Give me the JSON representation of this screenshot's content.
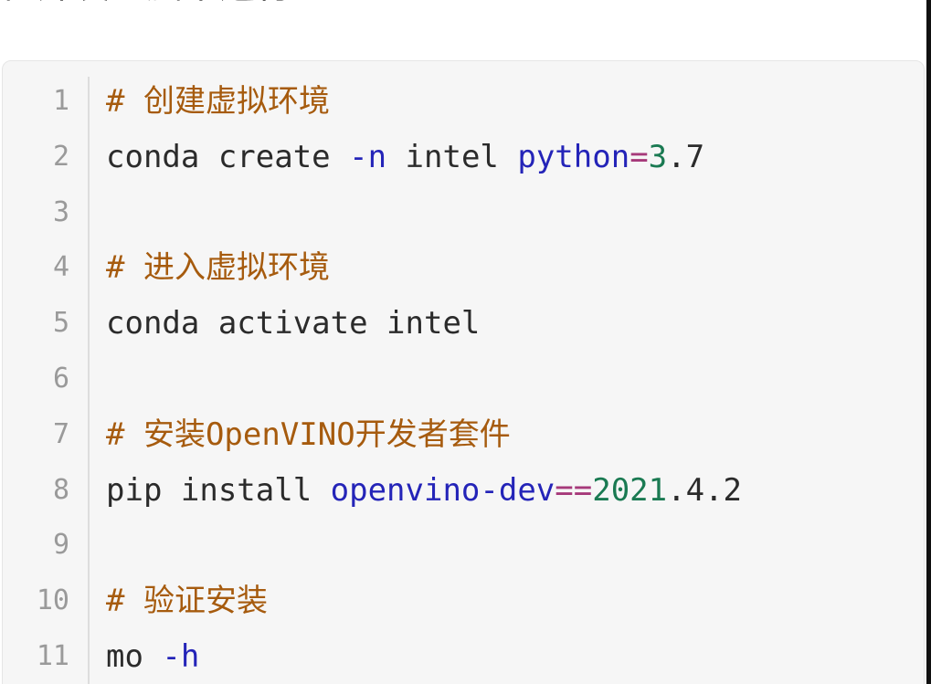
{
  "heading": "在开发电脑中运行",
  "colors": {
    "comment": "#a65b0e",
    "keyword": "#2424b8",
    "number": "#1a7a52",
    "operator": "#a6397a",
    "plain": "#2b2b2b",
    "line_number": "#9a9a9a",
    "code_background": "#f6f6f6"
  },
  "code": {
    "lines": [
      {
        "n": "1",
        "tokens": [
          {
            "t": "# 创建虚拟环境",
            "c": "comment"
          }
        ]
      },
      {
        "n": "2",
        "tokens": [
          {
            "t": "conda create ",
            "c": "plain"
          },
          {
            "t": "-n",
            "c": "kw"
          },
          {
            "t": " intel ",
            "c": "plain"
          },
          {
            "t": "python",
            "c": "kw"
          },
          {
            "t": "=",
            "c": "op"
          },
          {
            "t": "3",
            "c": "num"
          },
          {
            "t": ".7",
            "c": "plain"
          }
        ]
      },
      {
        "n": "3",
        "tokens": []
      },
      {
        "n": "4",
        "tokens": [
          {
            "t": "# 进入虚拟环境",
            "c": "comment"
          }
        ]
      },
      {
        "n": "5",
        "tokens": [
          {
            "t": "conda activate intel",
            "c": "plain"
          }
        ]
      },
      {
        "n": "6",
        "tokens": []
      },
      {
        "n": "7",
        "tokens": [
          {
            "t": "# 安装OpenVINO开发者套件",
            "c": "comment"
          }
        ]
      },
      {
        "n": "8",
        "tokens": [
          {
            "t": "pip install ",
            "c": "plain"
          },
          {
            "t": "openvino-dev",
            "c": "kw"
          },
          {
            "t": "==",
            "c": "op"
          },
          {
            "t": "2021",
            "c": "num"
          },
          {
            "t": ".4.2",
            "c": "plain"
          }
        ]
      },
      {
        "n": "9",
        "tokens": []
      },
      {
        "n": "10",
        "tokens": [
          {
            "t": "# 验证安装",
            "c": "comment"
          }
        ]
      },
      {
        "n": "11",
        "tokens": [
          {
            "t": "mo ",
            "c": "plain"
          },
          {
            "t": "-h",
            "c": "kw"
          }
        ]
      }
    ]
  }
}
